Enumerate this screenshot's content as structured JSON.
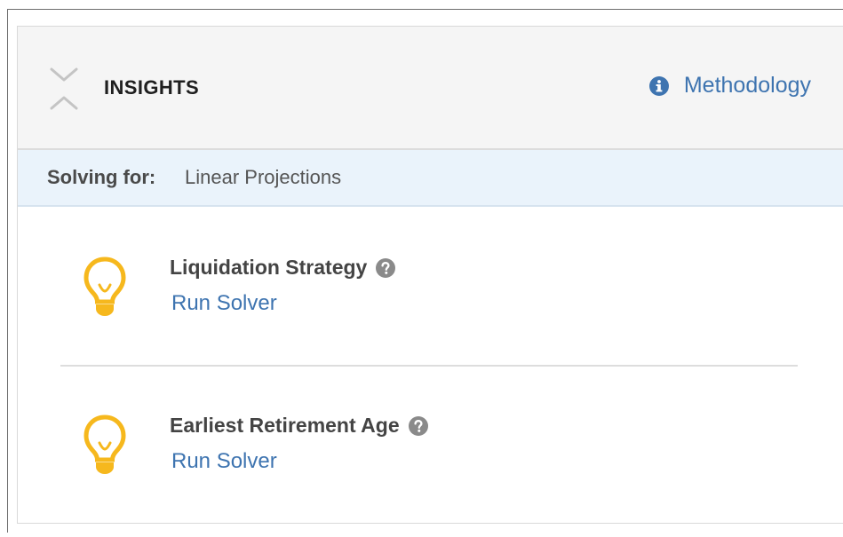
{
  "panel": {
    "title": "INSIGHTS",
    "methodology_label": "Methodology",
    "icons": {
      "collapse": "collapse-chevrons-icon",
      "info": "info-circle-icon",
      "help": "question-circle-icon",
      "insight": "lightbulb-icon"
    }
  },
  "solving_for": {
    "label": "Solving for:",
    "value": "Linear Projections"
  },
  "insights": [
    {
      "title": "Liquidation Strategy",
      "action": "Run Solver"
    },
    {
      "title": "Earliest Retirement Age",
      "action": "Run Solver"
    }
  ],
  "colors": {
    "link": "#3e74b0",
    "bulb": "#f6b81d",
    "header_bg": "#f5f5f5",
    "solving_bg": "#eaf3fb",
    "icon_gray": "#8a8a8a"
  }
}
